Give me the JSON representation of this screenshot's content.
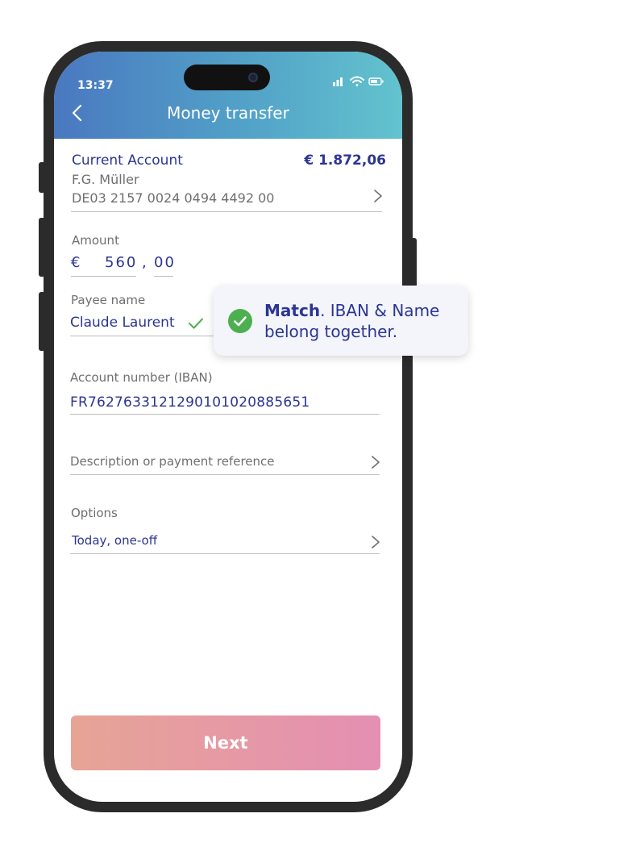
{
  "status_bar": {
    "time": "13:37"
  },
  "header": {
    "title": "Money transfer"
  },
  "account": {
    "type": "Current Account",
    "balance": "€ 1.872,06",
    "holder": "F.G. Müller",
    "iban": "DE03 2157 0024 0494 4492 00"
  },
  "amount": {
    "label": "Amount",
    "currency": "€",
    "whole": "560",
    "separator": ",",
    "cents": "00"
  },
  "payee": {
    "label": "Payee name",
    "value": "Claude Laurent"
  },
  "tooltip": {
    "bold": "Match",
    "text": ". IBAN & Name belong together."
  },
  "iban_field": {
    "label": "Account number (IBAN)",
    "value": "FR7627633121290101020885651"
  },
  "reference": {
    "placeholder": "Description or payment reference"
  },
  "options": {
    "label": "Options",
    "value": "Today, one-off"
  },
  "next_button": {
    "label": "Next"
  },
  "colors": {
    "accent_text": "#2c3593",
    "header_gradient_start": "#4a78c0",
    "header_gradient_end": "#63c3ce",
    "match_green": "#4caf50",
    "button_gradient_start": "#e7a495",
    "button_gradient_end": "#e48fb3"
  }
}
